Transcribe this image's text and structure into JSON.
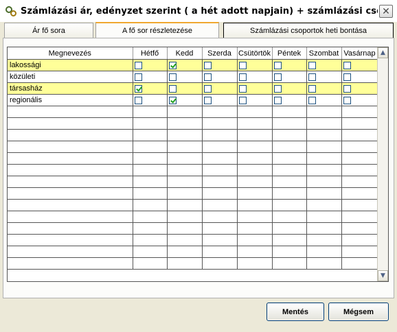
{
  "window": {
    "title": "Számlázási ár, edényzet szerint ( a hét adott napjain) + számlázási csoportok het...",
    "close_glyph": "✕"
  },
  "tabs": [
    {
      "label": "Ár fő sora"
    },
    {
      "label": "A fő sor részletezése"
    },
    {
      "label": "Számlázási csoportok heti bontása"
    }
  ],
  "grid": {
    "columns": [
      "Megnevezés",
      "Hétfő",
      "Kedd",
      "Szerda",
      "Csütörtök",
      "Péntek",
      "Szombat",
      "Vasárnap"
    ],
    "rows": [
      {
        "name": "lakossági",
        "highlight": true,
        "days": [
          false,
          true,
          false,
          false,
          false,
          false,
          false
        ]
      },
      {
        "name": "közületi",
        "highlight": false,
        "days": [
          false,
          false,
          false,
          false,
          false,
          false,
          false
        ]
      },
      {
        "name": "társasház",
        "highlight": true,
        "days": [
          true,
          false,
          false,
          false,
          false,
          false,
          false
        ]
      },
      {
        "name": "regionális",
        "highlight": false,
        "days": [
          false,
          true,
          false,
          false,
          false,
          false,
          false
        ]
      }
    ],
    "empty_rows": 14,
    "highlight_color": "#ffff99"
  },
  "scrollbar": {
    "up_icon": "▲",
    "down_icon": "▼"
  },
  "buttons": {
    "save": "Mentés",
    "cancel": "Mégsem"
  },
  "colors": {
    "check": "#21a121",
    "tab_active_accent": "#f0a830"
  }
}
